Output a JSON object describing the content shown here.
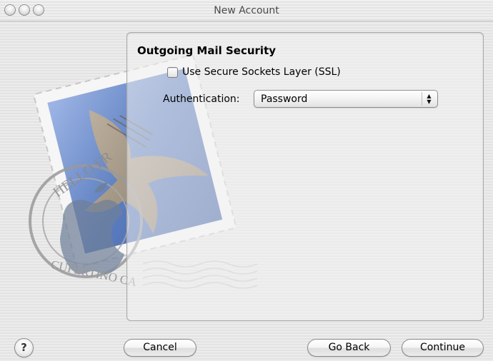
{
  "window": {
    "title": "New Account",
    "controls": [
      "close",
      "minimize",
      "zoom"
    ]
  },
  "artwork": {
    "name": "mail-stamp-artwork",
    "postmark_top_text": "HELLO FR",
    "postmark_bottom_text": "CUPERTINO CA"
  },
  "panel": {
    "section_title": "Outgoing Mail Security",
    "ssl": {
      "label": "Use Secure Sockets Layer (SSL)",
      "checked": false
    },
    "authentication": {
      "label": "Authentication:",
      "selected": "Password"
    }
  },
  "buttons": {
    "help": "?",
    "cancel": "Cancel",
    "go_back": "Go Back",
    "continue": "Continue"
  },
  "colors": {
    "stamp_blue": "#5d7fc0",
    "panel_border": "#a9a9a9",
    "window_bg": "#e8e8e8"
  }
}
